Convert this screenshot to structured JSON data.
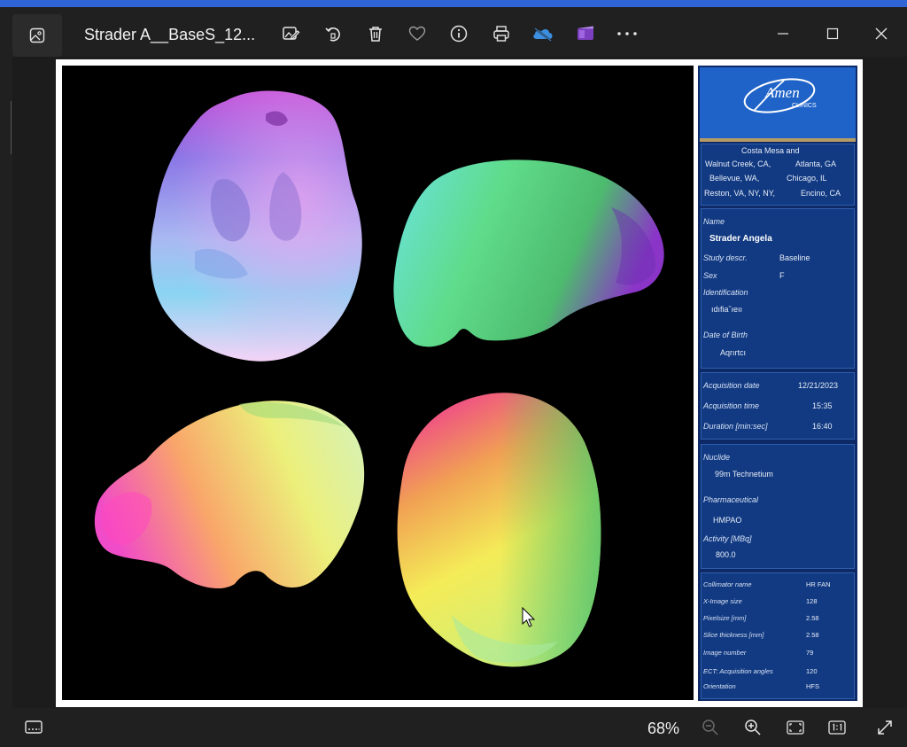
{
  "window": {
    "title": "Strader A__BaseS_12...",
    "toolbar_icons": [
      "edit-image-icon",
      "rotate-icon",
      "delete-icon",
      "favorite-icon",
      "info-icon",
      "print-icon",
      "onedrive-icon",
      "clipchamp-icon",
      "more-icon"
    ],
    "controls": [
      "minimize-icon",
      "maximize-icon",
      "close-icon"
    ]
  },
  "sidebar": {
    "logo_top": "Amen",
    "logo_bottom": "CLINICS",
    "locations": {
      "line1": "Costa Mesa and",
      "c1": [
        "Walnut Creek, CA,",
        "Bellevue, WA,",
        "Reston, VA, NY, NY,"
      ],
      "c2": [
        "Atlanta, GA",
        "Chicago, IL",
        "Encino, CA"
      ]
    },
    "patient": {
      "name_label": "Name",
      "name_value": "Strader Angela",
      "study_label": "Study descr.",
      "study_value": "Baseline",
      "sex_label": "Sex",
      "sex_value": "F",
      "id_label": "Identification",
      "id_value": "ıdıfiaˇıeıı",
      "dob_label": "Date of Birth",
      "dob_value": "Aqrırtcı"
    },
    "acquisition": {
      "date_label": "Acquisition date",
      "date_value": "12/21/2023",
      "time_label": "Acquisition time",
      "time_value": "15:35",
      "duration_label": "Duration [min:sec]",
      "duration_value": "16:40"
    },
    "nuclide": {
      "nuclide_label": "Nuclide",
      "nuclide_value": "99m Technetium",
      "pharm_label": "Pharmaceutical",
      "pharm_value": "HMPAO",
      "activity_label": "Activity [MBq]",
      "activity_value": "800.0"
    },
    "params": {
      "collimator_label": "Collimator name",
      "collimator_value": "HR FAN",
      "xsize_label": "X-Image size",
      "xsize_value": "128",
      "pixelsize_label": "Pixelsize [mm]",
      "pixelsize_value": "2.58",
      "slice_label": "Slice thickness [mm]",
      "slice_value": "2.58",
      "imgnum_label": "Image number",
      "imgnum_value": "79",
      "angles_label": "ECT: Acquisition angles",
      "angles_value": "120",
      "orient_label": "Orientation",
      "orient_value": "HFS"
    }
  },
  "bottom": {
    "zoom": "68%",
    "icons": [
      "filmstrip-icon",
      "zoom-out-icon",
      "zoom-in-icon",
      "fit-to-window-icon",
      "actual-size-icon",
      "fullscreen-icon"
    ]
  },
  "colors": {
    "accent": "#2f64d6",
    "sidebar_bg": "#0d2a66",
    "panel_bg": "#123a82",
    "logo_bg": "#1f63c8"
  }
}
